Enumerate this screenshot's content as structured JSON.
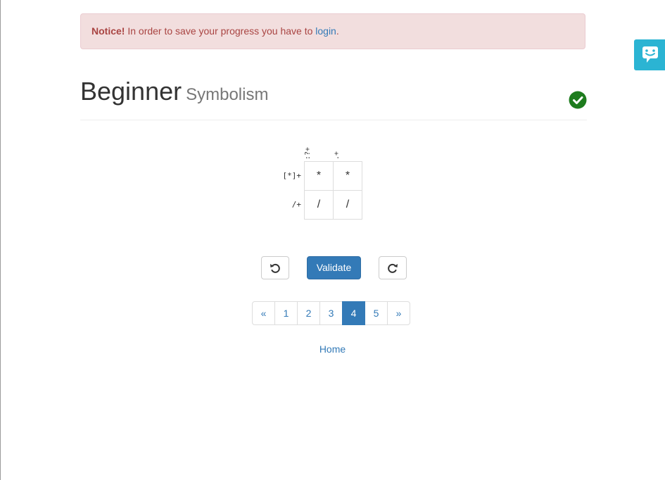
{
  "notice": {
    "label": "Notice!",
    "text": " In order to save your progress you have to ",
    "link": "login",
    "suffix": "."
  },
  "header": {
    "title": "Beginner",
    "subtitle": "Symbolism",
    "completed_icon": "check-circle-icon",
    "completed_color": "#1e7c1e"
  },
  "feedback_tab": {
    "icon": "chat-smile-icon",
    "color": "#2bb4d3"
  },
  "puzzle": {
    "column_clues": [
      ":?+",
      ".+"
    ],
    "row_clues": [
      "[*]+",
      "/+"
    ],
    "cells": [
      [
        "*",
        "*"
      ],
      [
        "/",
        "/"
      ]
    ]
  },
  "controls": {
    "undo_icon": "undo-icon",
    "validate_label": "Validate",
    "redo_icon": "redo-icon"
  },
  "pagination": {
    "prev": "«",
    "pages": [
      "1",
      "2",
      "3",
      "4",
      "5"
    ],
    "active": "4",
    "next": "»"
  },
  "home_link": "Home",
  "colors": {
    "primary": "#337ab7",
    "alert_bg": "#f2dede",
    "alert_text": "#a94442"
  }
}
